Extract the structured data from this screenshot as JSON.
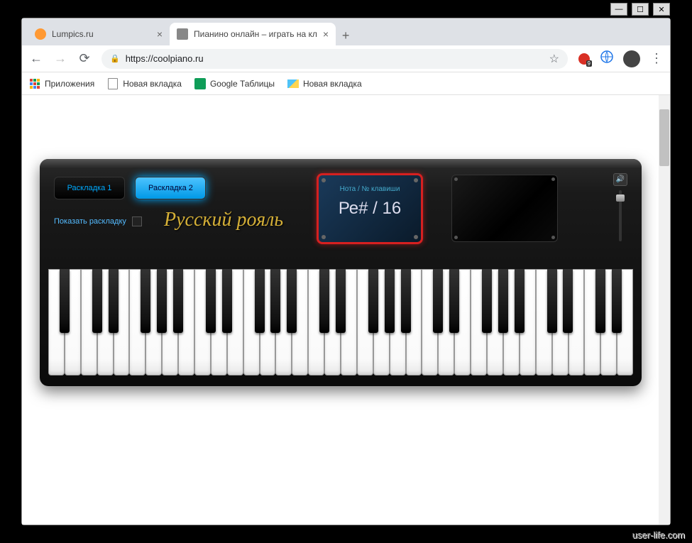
{
  "window": {
    "tabs": [
      {
        "title": "Lumpics.ru",
        "active": false
      },
      {
        "title": "Пианино онлайн – играть на кл",
        "active": true
      }
    ]
  },
  "nav": {
    "url_prefix": "https://",
    "url_host": "coolpiano.ru",
    "ext_badge": "9"
  },
  "bookmarks": {
    "apps": "Приложения",
    "newTab1": "Новая вкладка",
    "sheets": "Google Таблицы",
    "newTab2": "Новая вкладка"
  },
  "piano": {
    "layout1": "Раскладка 1",
    "layout2": "Раскладка 2",
    "showLayout": "Показать раскладку",
    "logo": "Русский рояль",
    "displayLabel": "Нота / № клавиши",
    "displayValue": "Ре# / 16"
  },
  "watermark": "user-life.com",
  "keyboard": {
    "whiteKeys": 36,
    "blackKeyPattern": [
      1,
      1,
      0,
      1,
      1,
      1,
      0
    ]
  }
}
